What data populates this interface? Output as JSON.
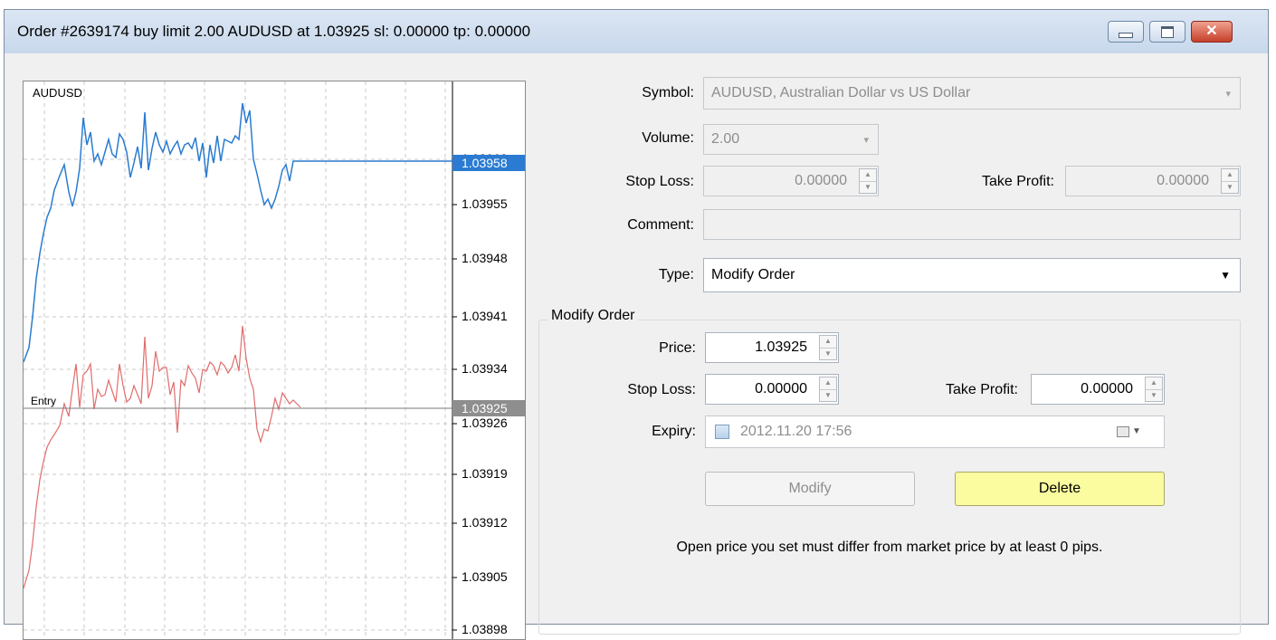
{
  "window": {
    "title": "Order #2639174 buy limit 2.00 AUDUSD at 1.03925 sl: 0.00000 tp: 0.00000",
    "minimize": "minimize",
    "maximize": "maximize",
    "close": "✕"
  },
  "chart": {
    "symbol": "AUDUSD",
    "entry_label": "Entry",
    "price_labels": [
      "1.03962",
      "1.03955",
      "1.03948",
      "1.03941",
      "1.03934",
      "1.03926",
      "1.03919",
      "1.03912",
      "1.03905",
      "1.03898"
    ],
    "bid_marker": "1.03958",
    "entry_marker": "1.03925",
    "colors": {
      "bid_line": "#2a7bd1",
      "ask_line": "#e06c6c",
      "marker_bg": "#2a7bd1",
      "entry_marker_bg": "#8e8e8e"
    }
  },
  "form": {
    "symbol_label": "Symbol:",
    "symbol_value": "AUDUSD, Australian Dollar vs US Dollar",
    "volume_label": "Volume:",
    "volume_value": "2.00",
    "stop_loss_label": "Stop Loss:",
    "stop_loss_value": "0.00000",
    "take_profit_label": "Take Profit:",
    "take_profit_value": "0.00000",
    "comment_label": "Comment:",
    "comment_value": "",
    "type_label": "Type:",
    "type_value": "Modify Order"
  },
  "modify": {
    "group_title": "Modify Order",
    "price_label": "Price:",
    "price_value": "1.03925",
    "stop_loss_label": "Stop Loss:",
    "stop_loss_value": "0.00000",
    "take_profit_label": "Take Profit:",
    "take_profit_value": "0.00000",
    "expiry_label": "Expiry:",
    "expiry_value": "2012.11.20 17:56",
    "modify_button": "Modify",
    "delete_button": "Delete",
    "note": "Open price you set must differ from market price by at least 0 pips."
  }
}
